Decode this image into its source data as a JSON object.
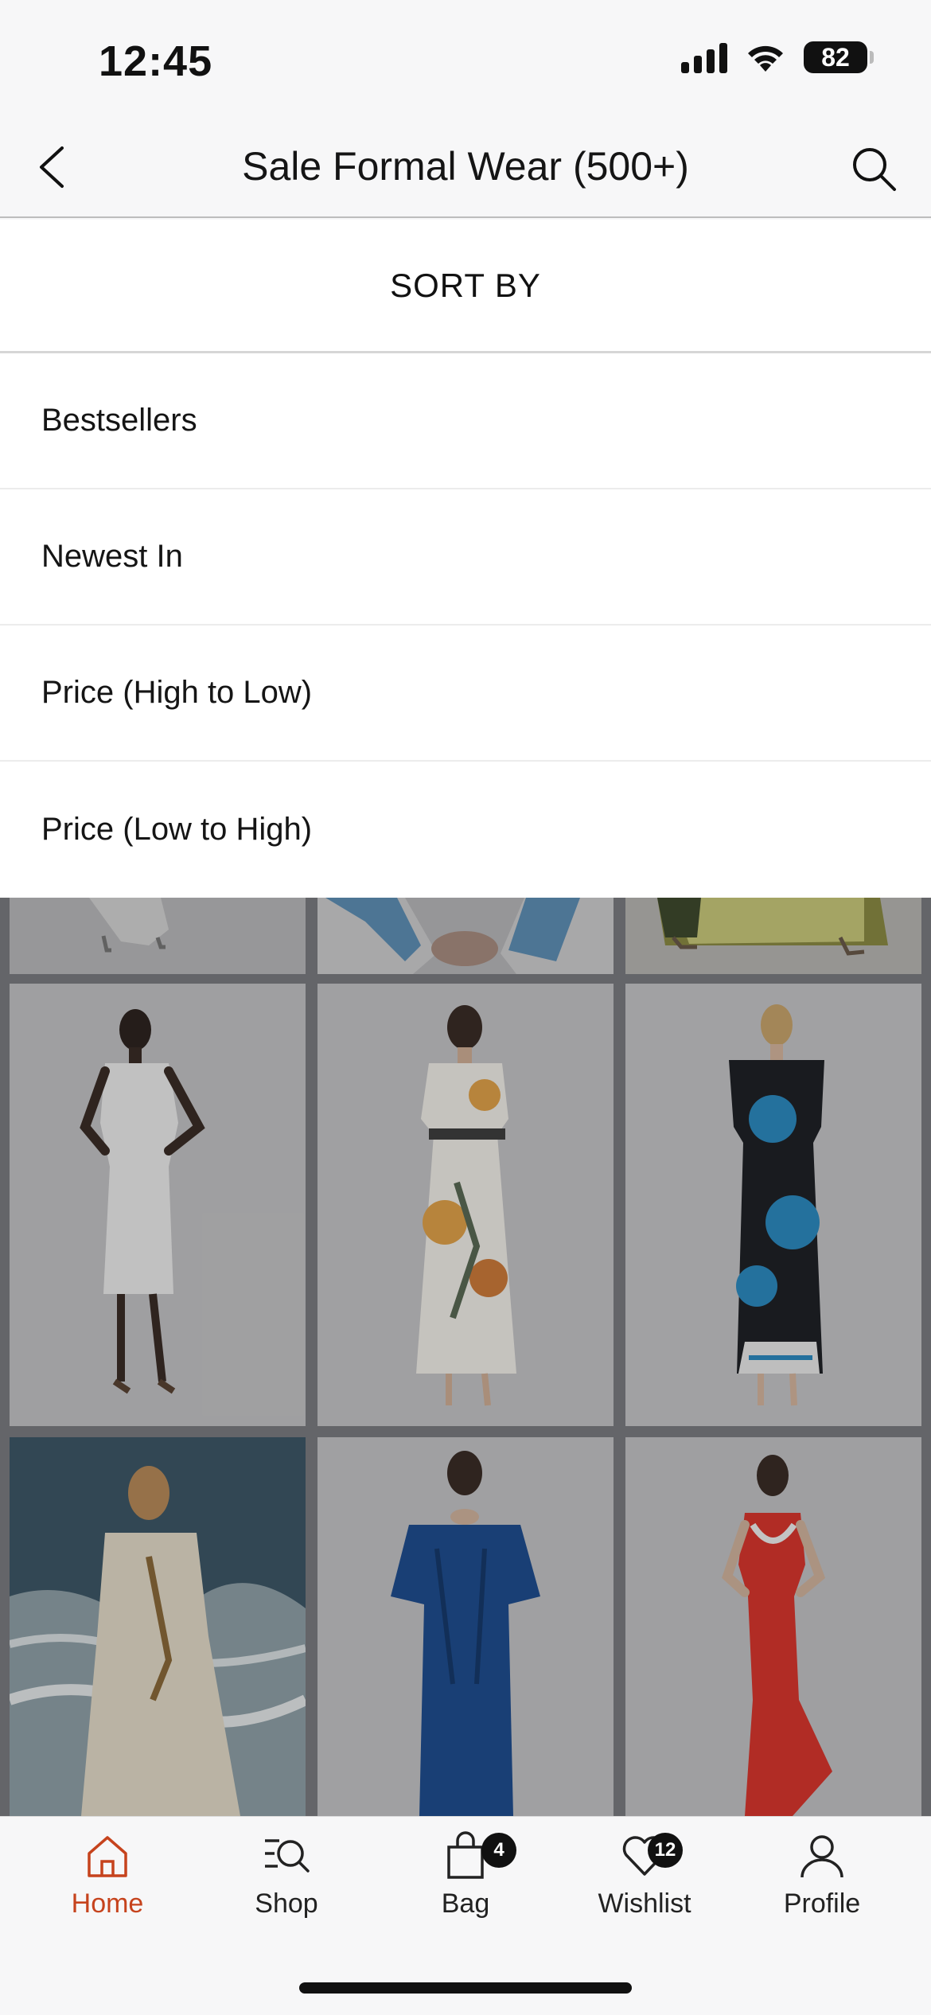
{
  "status_bar": {
    "time": "12:45",
    "battery": "82"
  },
  "header": {
    "title": "Sale Formal Wear (500+)"
  },
  "sort_sheet": {
    "title": "SORT BY",
    "options": [
      {
        "label": "Bestsellers"
      },
      {
        "label": "Newest In"
      },
      {
        "label": "Price (High to Low)"
      },
      {
        "label": "Price (Low to High)"
      }
    ]
  },
  "products": [
    {
      "description": "white dress (partial)"
    },
    {
      "description": "blue sleeve (partial)"
    },
    {
      "description": "yellow pleated skirt (partial)"
    },
    {
      "description": "white midi dress"
    },
    {
      "description": "floral print maxi dress"
    },
    {
      "description": "black blue floral dress"
    },
    {
      "description": "cream beach gown"
    },
    {
      "description": "blue satin dress"
    },
    {
      "description": "red mermaid dress"
    }
  ],
  "tab_bar": {
    "tabs": [
      {
        "label": "Home",
        "icon": "home-icon",
        "active": true
      },
      {
        "label": "Shop",
        "icon": "shop-search-icon"
      },
      {
        "label": "Bag",
        "icon": "bag-icon",
        "badge": "4"
      },
      {
        "label": "Wishlist",
        "icon": "heart-icon",
        "badge": "12"
      },
      {
        "label": "Profile",
        "icon": "profile-icon"
      }
    ]
  },
  "colors": {
    "accent": "#c6431d",
    "badge": "#111111"
  }
}
